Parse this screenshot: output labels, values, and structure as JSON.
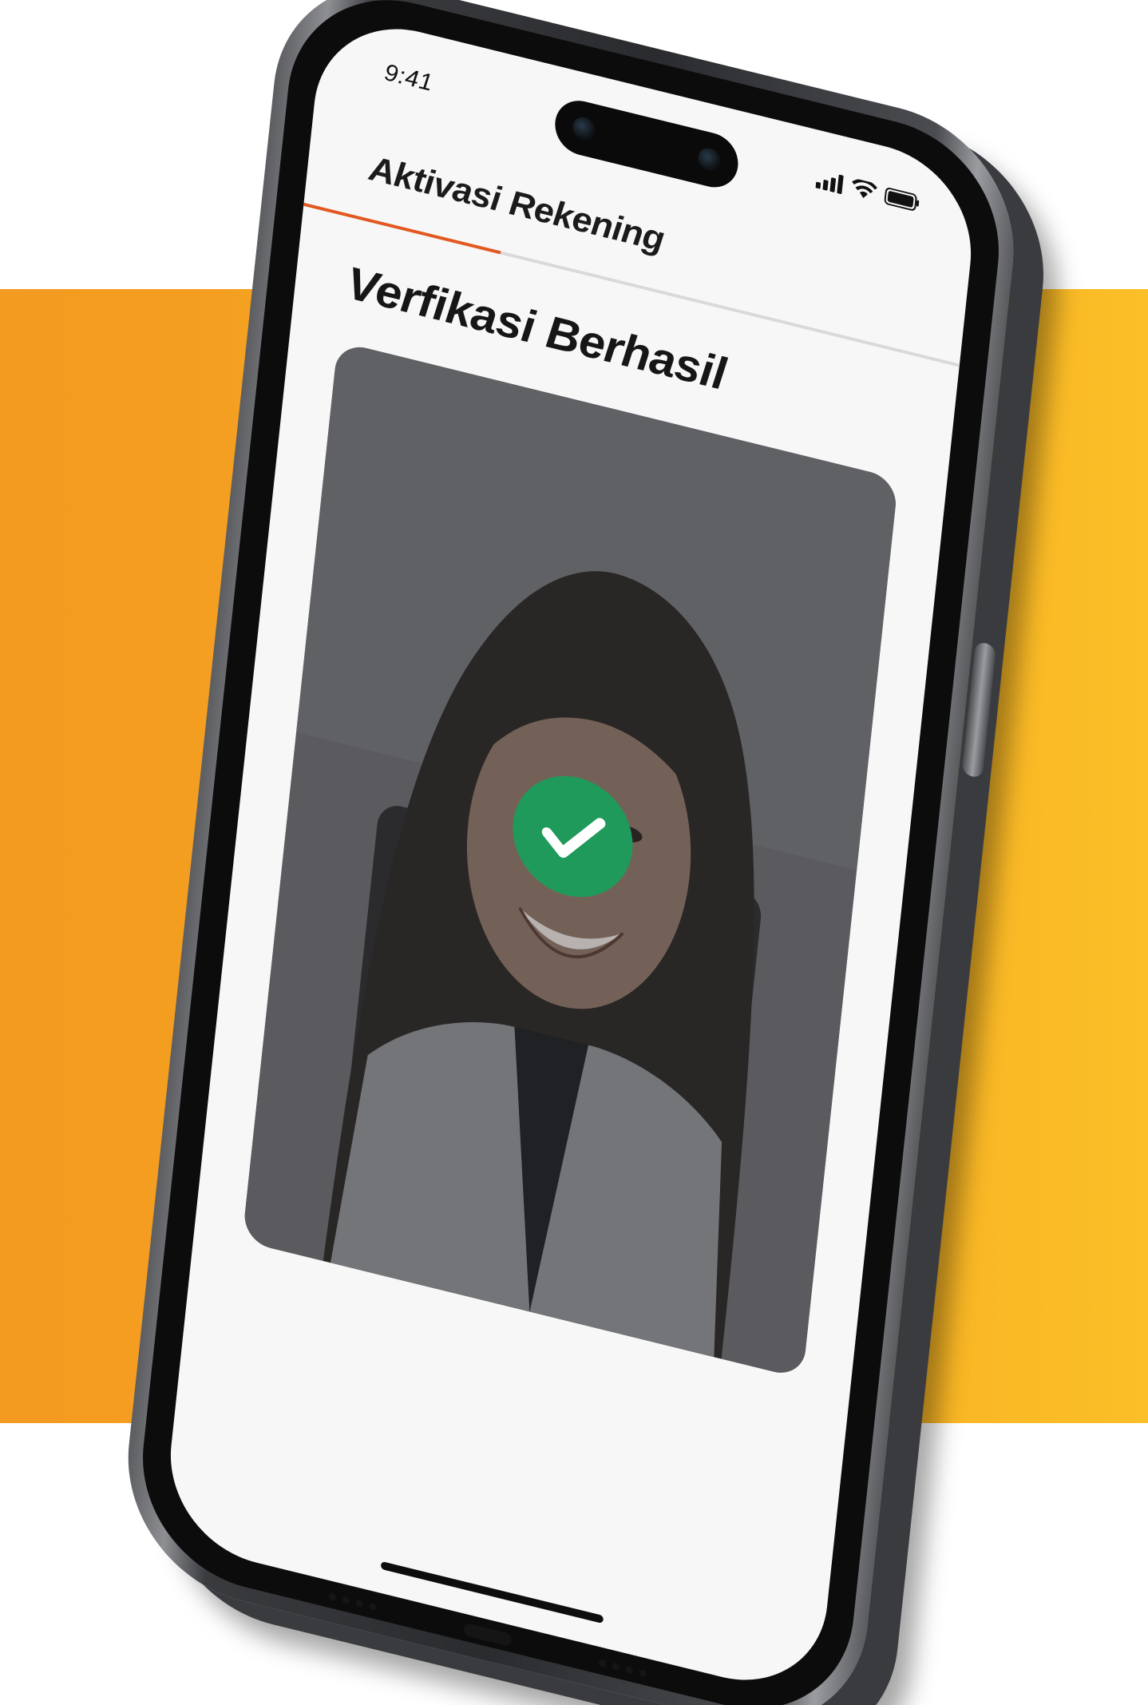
{
  "status_bar": {
    "time": "9:41",
    "icons": [
      "signal-icon",
      "wifi-icon",
      "battery-icon"
    ]
  },
  "header": {
    "title": "Aktivasi Rekening",
    "progress_fraction": 0.3,
    "accent_color": "#e2581f"
  },
  "main": {
    "title": "Verfikasi Berhasil",
    "photo_description_icon": "selfie-photo",
    "status_icon": "check-circle-icon",
    "success_color": "#1f9a5b"
  },
  "background": {
    "band_color_start": "#f39a20",
    "band_color_end": "#fbbf27"
  }
}
